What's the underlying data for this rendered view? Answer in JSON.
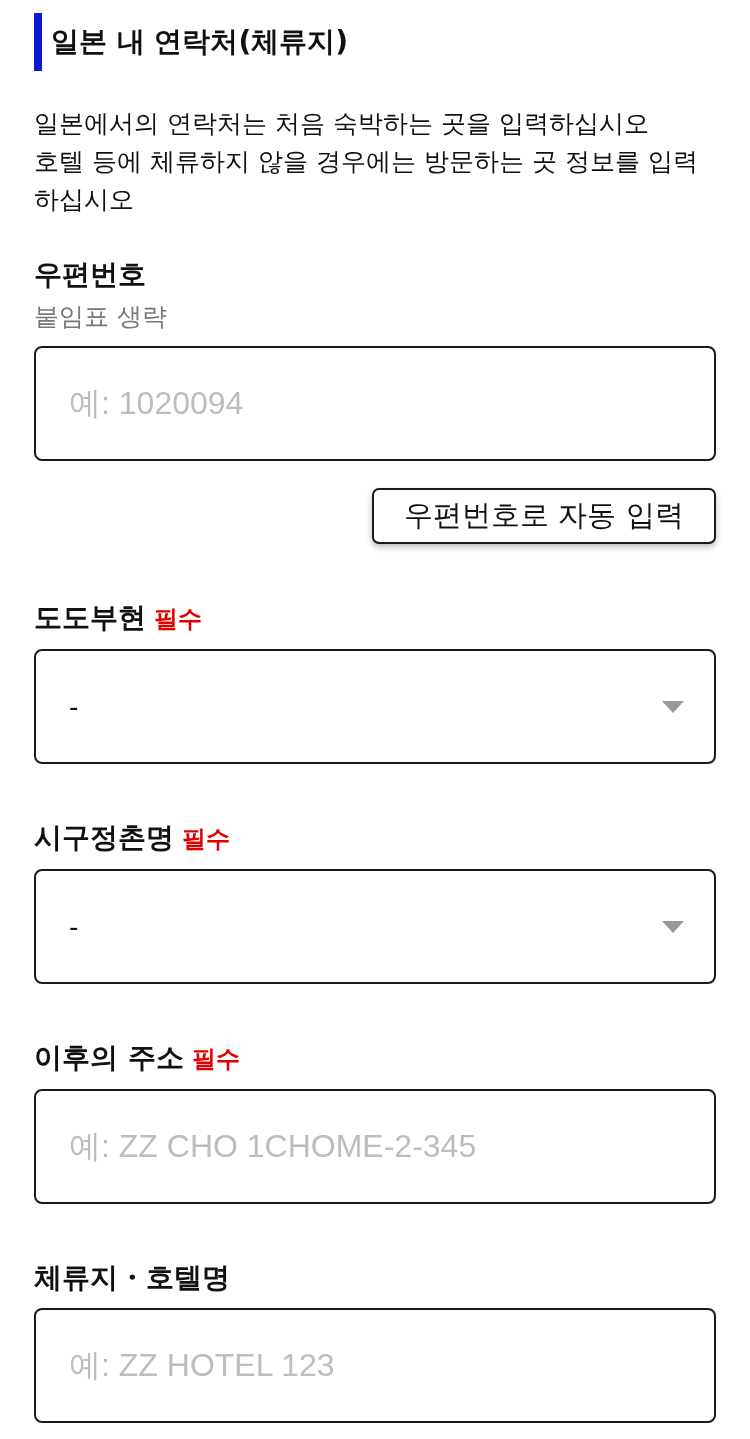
{
  "section": {
    "title": "일본 내 연락처(체류지)",
    "description": [
      "일본에서의 연락처는 처음 숙박하는 곳을 입력하십시오",
      "호텔 등에 체류하지 않을 경우에는 방문하는 곳 정보를 입력하십시오"
    ]
  },
  "fields": [
    {
      "kind": "text",
      "label": "우편번호",
      "hint": "붙임표 생략",
      "placeholder": "예: 1020094",
      "button": {
        "label": "우편번호로 자동 입력"
      }
    },
    {
      "kind": "select",
      "label": "도도부현",
      "required_mark": "필수",
      "value": "-"
    },
    {
      "kind": "select",
      "label": "시구정촌명",
      "required_mark": "필수",
      "value": "-"
    },
    {
      "kind": "text",
      "label": "이후의 주소",
      "required_mark": "필수",
      "placeholder": "예: ZZ CHO 1CHOME-2-345"
    },
    {
      "kind": "text",
      "label": "체류지・호텔명",
      "placeholder": "예: ZZ HOTEL 123"
    }
  ]
}
